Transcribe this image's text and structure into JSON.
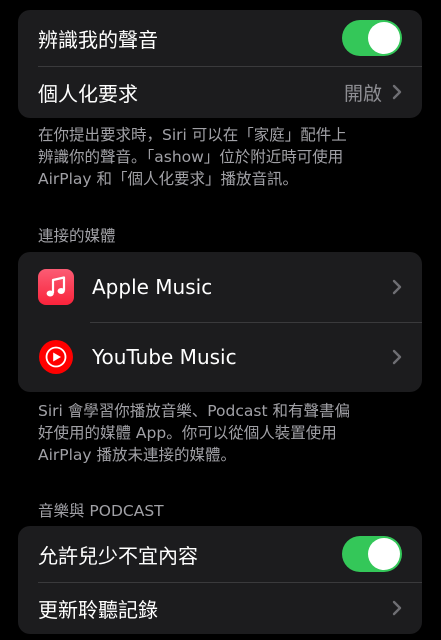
{
  "group1": {
    "recognize_voice": {
      "label": "辨識我的聲音",
      "toggle": true
    },
    "personal_requests": {
      "label": "個人化要求",
      "value": "開啟"
    }
  },
  "note1": {
    "line1": "在你提出要求時，Siri 可以在「家庭」配件上",
    "line2": "辨識你的聲音。「ashow」位於附近時可使用",
    "line3": "AirPlay 和「個人化要求」播放音訊。"
  },
  "connected_media": {
    "header": "連接的媒體",
    "apps": [
      {
        "label": "Apple Music",
        "icon": "apple-music-icon"
      },
      {
        "label": "YouTube Music",
        "icon": "youtube-music-icon"
      }
    ]
  },
  "note2": {
    "line1": "Siri 會學習你播放音樂、Podcast 和有聲書偏",
    "line2": "好使用的媒體 App。你可以從個人裝置使用",
    "line3": "AirPlay 播放未連接的媒體。"
  },
  "music_podcast": {
    "header": "音樂與 PODCAST",
    "allow_explicit": {
      "label": "允許兒少不宜內容",
      "toggle": true
    },
    "update_history": {
      "label": "更新聆聽記錄"
    }
  },
  "colors": {
    "background": "#000000",
    "cell": "#1c1c1e",
    "toggle_on": "#34c759",
    "secondary_text": "#8e8e93",
    "apple_music": "#fa233b",
    "youtube_music": "#ff0000"
  }
}
